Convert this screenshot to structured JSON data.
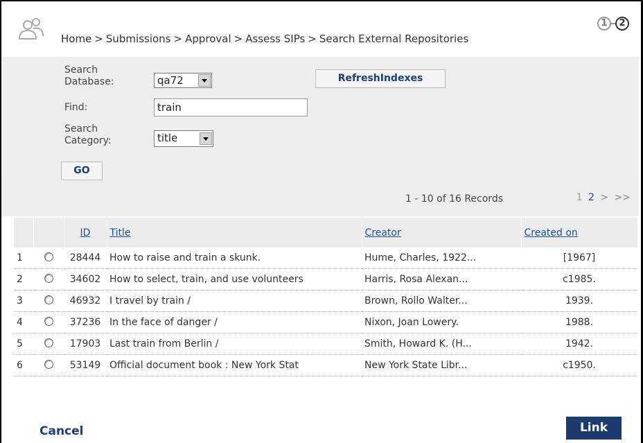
{
  "breadcrumb": [
    "Home",
    "Submissions",
    "Approval",
    "Assess SIPs",
    "Search External Repositories"
  ],
  "breadcrumb_sep": ">",
  "steps": [
    "1",
    "2"
  ],
  "form": {
    "search_database_label_1": "Search",
    "search_database_label_2": "Database:",
    "search_database_value": "qa72",
    "find_label": "Find:",
    "find_value": "train",
    "search_category_label_1": "Search",
    "search_category_label_2": "Category:",
    "search_category_value": "title",
    "refresh_label": "RefreshIndexes",
    "go_label": "GO"
  },
  "records": {
    "count_text": "1 - 10 of 16 Records",
    "pages": [
      "1",
      "2"
    ],
    "next": ">",
    "last": ">>"
  },
  "table": {
    "headers": {
      "id": "ID",
      "title": "Title",
      "creator": "Creator",
      "created_on": "Created on"
    },
    "rows": [
      {
        "n": "1",
        "id": "28444",
        "title": "How to raise and train a skunk.",
        "creator": "Hume, Charles, 1922...",
        "created_on": "[1967]"
      },
      {
        "n": "2",
        "id": "34602",
        "title": "How to select, train, and use volunteers",
        "creator": "Harris, Rosa Alexan...",
        "created_on": "c1985."
      },
      {
        "n": "3",
        "id": "46932",
        "title": "I travel by train /",
        "creator": "Brown, Rollo Walter...",
        "created_on": "1939."
      },
      {
        "n": "4",
        "id": "37236",
        "title": "In the face of danger /",
        "creator": "Nixon, Joan Lowery.",
        "created_on": "1988."
      },
      {
        "n": "5",
        "id": "17903",
        "title": "Last train from Berlin /",
        "creator": "Smith, Howard K. (H...",
        "created_on": "1942."
      },
      {
        "n": "6",
        "id": "53149",
        "title": "Official document book : New York Stat",
        "creator": "New York State Libr...",
        "created_on": "c1950."
      }
    ]
  },
  "footer": {
    "cancel_label": "Cancel",
    "link_label": "Link"
  }
}
